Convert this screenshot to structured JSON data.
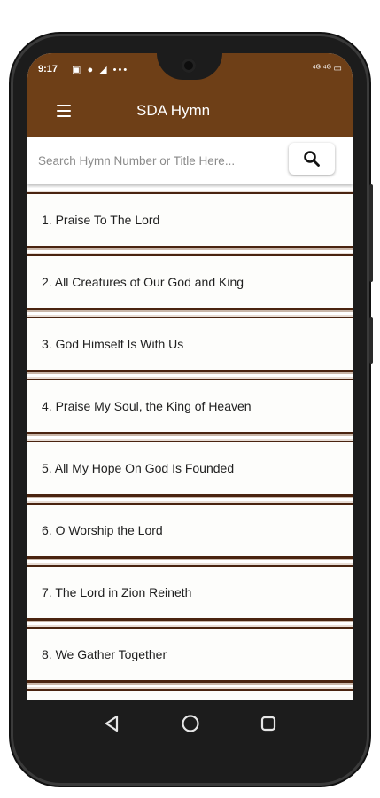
{
  "status_bar": {
    "time": "9:17",
    "left_icons": "▣ ● ◢ •••",
    "right_icons": "⁴ᴳ ⁴ᴳ ▭"
  },
  "app_bar": {
    "title": "SDA Hymn",
    "menu_icon": "menu-icon"
  },
  "search": {
    "placeholder": "Search Hymn Number or Title Here...",
    "value": "",
    "button_icon": "search-icon"
  },
  "hymns": [
    {
      "label": "1. Praise To The Lord"
    },
    {
      "label": "2. All Creatures of Our God and King"
    },
    {
      "label": "3. God Himself Is With Us"
    },
    {
      "label": "4. Praise My Soul, the King of Heaven"
    },
    {
      "label": "5. All My Hope On God Is Founded"
    },
    {
      "label": "6. O Worship the Lord"
    },
    {
      "label": "7. The Lord in Zion Reineth"
    },
    {
      "label": "8. We Gather Together"
    },
    {
      "label": ""
    }
  ],
  "colors": {
    "brand": "#6e3f17",
    "card_border": "#4a2410",
    "card_bg": "#fdfdfb"
  },
  "nav": [
    "back-icon",
    "home-icon",
    "recents-icon"
  ]
}
